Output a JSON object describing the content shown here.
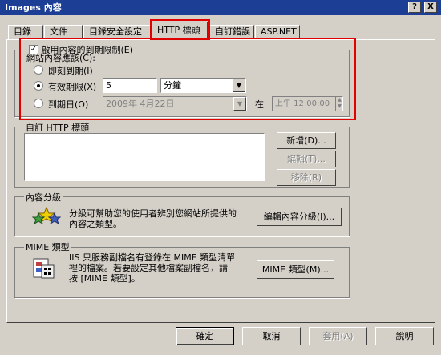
{
  "window": {
    "title": "Images 內容",
    "help_button": "?",
    "close_button": "X"
  },
  "tabs": [
    {
      "label": "目錄"
    },
    {
      "label": "文件"
    },
    {
      "label": "目錄安全設定"
    },
    {
      "label": "HTTP 標頭",
      "active": true
    },
    {
      "label": "自訂錯誤"
    },
    {
      "label": "ASP.NET"
    }
  ],
  "expiration": {
    "enable_label": "啟用內容的到期限制(E)",
    "enabled": true,
    "expire_label": "網站內容應該(C):",
    "options": [
      {
        "label": "即刻到期(I)",
        "selected": false
      },
      {
        "label": "有效期限(X)",
        "selected": true
      },
      {
        "label": "到期日(O)",
        "selected": false
      }
    ],
    "duration_value": "5",
    "duration_unit": "分鐘",
    "date_value": "2009年 4月22日",
    "at_label": "在",
    "time_value": "上午 12:00:00"
  },
  "custom_headers": {
    "title": "自訂 HTTP 標頭",
    "add_button": "新增(D)...",
    "edit_button": "編輯(T)...",
    "remove_button": "移除(R)"
  },
  "content_rating": {
    "title": "內容分級",
    "description_line1": "分級可幫助您的使用者辨別您網站所提供的",
    "description_line2": "內容之類型。",
    "edit_button": "編輯內容分級(I)..."
  },
  "mime": {
    "title": "MIME 類型",
    "description_line1": "IIS 只服務副檔名有登錄在 MIME 類型清單",
    "description_line2": "裡的檔案。若要設定其他檔案副檔名，請",
    "description_line3": "按 [MIME 類型]。",
    "button": "MIME 類型(M)..."
  },
  "footer": {
    "ok": "確定",
    "cancel": "取消",
    "apply": "套用(A)",
    "help": "說明"
  },
  "colors": {
    "titlebar": "#1c3f95",
    "face": "#d4d0c8",
    "highlight_box": "#e00000"
  }
}
